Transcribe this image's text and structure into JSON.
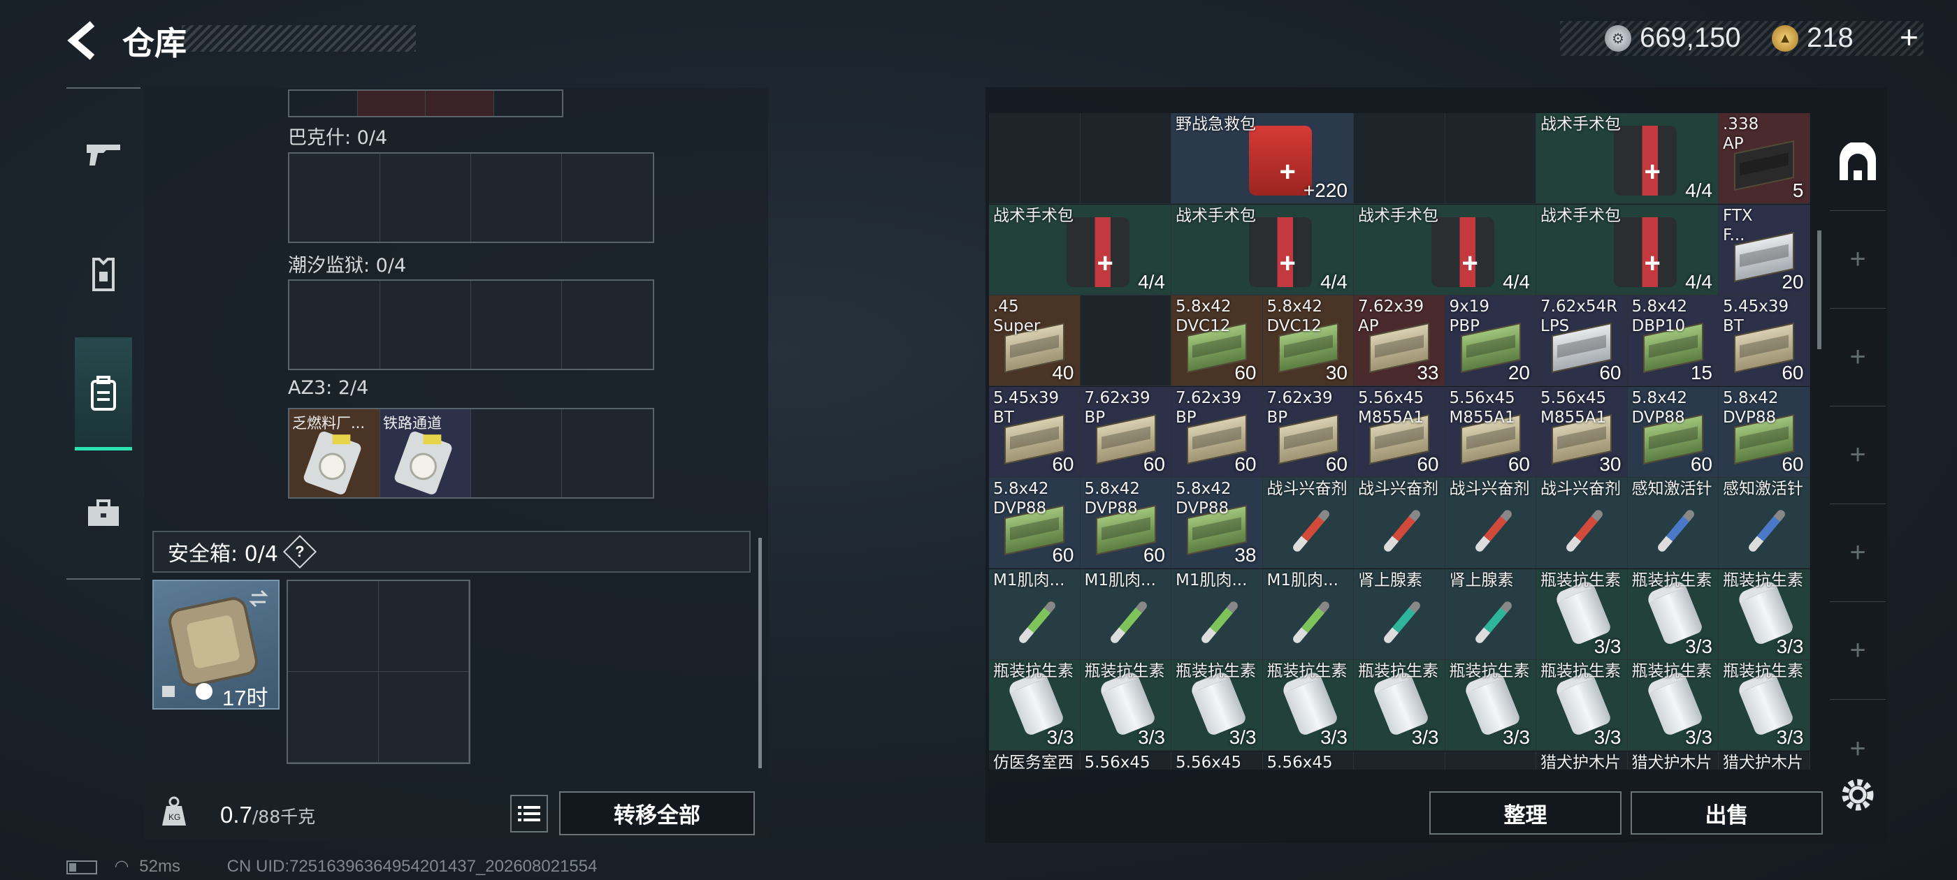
{
  "header": {
    "title": "仓库",
    "currency1": "669,150",
    "currency2": "218",
    "plus": "+"
  },
  "nav": [
    "weapon-icon",
    "armor-icon",
    "backpack-icon",
    "case-icon"
  ],
  "left": {
    "key_sections": [
      {
        "label": "巴克什: 0/4",
        "keys": []
      },
      {
        "label": "潮汐监狱: 0/4",
        "keys": []
      },
      {
        "label": "AZ3: 2/4",
        "keys": [
          "乏燃料厂...",
          "铁路通道"
        ]
      }
    ],
    "safe_label": "安全箱: 0/4",
    "help": "?",
    "safe_timer": "17时",
    "weight_value": "0.7",
    "weight_unit": "/88千克",
    "transfer_all": "转移全部"
  },
  "status": {
    "ping": "52ms",
    "uid": "CN UID:72516396364954201437_202608021554"
  },
  "right": {
    "sort_label": "整理",
    "sell_label": "出售",
    "rows": [
      [
        {
          "n": "",
          "c": "",
          "bg": "dark",
          "t": ""
        },
        {
          "n": "",
          "c": "",
          "bg": "dark",
          "t": ""
        },
        {
          "n": "野战急救包",
          "c": "+220",
          "bg": "blue",
          "t": "medkit",
          "w": 2
        },
        {
          "n": "",
          "c": "",
          "bg": "dark",
          "t": ""
        },
        {
          "n": "",
          "c": "",
          "bg": "dark",
          "t": ""
        },
        {
          "n": "战术手术包",
          "c": "4/4",
          "bg": "green",
          "t": "kit",
          "w": 2
        },
        {
          "n": ".338\nAP",
          "c": "5",
          "bg": "red",
          "t": "box"
        }
      ],
      [
        {
          "n": "战术手术包",
          "c": "4/4",
          "bg": "green",
          "t": "kit",
          "w": 2
        },
        {
          "n": "战术手术包",
          "c": "4/4",
          "bg": "green",
          "t": "kit",
          "w": 2
        },
        {
          "n": "战术手术包",
          "c": "4/4",
          "bg": "green",
          "t": "kit",
          "w": 2
        },
        {
          "n": "战术手术包",
          "c": "4/4",
          "bg": "green",
          "t": "kit",
          "w": 2
        },
        {
          "n": "FTX\nF...",
          "c": "20",
          "bg": "purple",
          "t": "ammow"
        }
      ],
      [
        {
          "n": ".45\nSuper",
          "c": "40",
          "bg": "orange",
          "t": "ammo"
        },
        {
          "n": "",
          "c": "",
          "bg": "dark",
          "t": ""
        },
        {
          "n": "5.8x42\nDVC12",
          "c": "60",
          "bg": "orange",
          "t": "ammog"
        },
        {
          "n": "5.8x42\nDVC12",
          "c": "30",
          "bg": "orange",
          "t": "ammog"
        },
        {
          "n": "7.62x39\nAP",
          "c": "33",
          "bg": "red",
          "t": "ammo"
        },
        {
          "n": "9x19\nPBP",
          "c": "20",
          "bg": "purple",
          "t": "ammog"
        },
        {
          "n": "7.62x54R\nLPS",
          "c": "60",
          "bg": "purple",
          "t": "ammow"
        },
        {
          "n": "5.8x42\nDBP10",
          "c": "15",
          "bg": "purple",
          "t": "ammog"
        },
        {
          "n": "5.45x39\nBT",
          "c": "60",
          "bg": "purple",
          "t": "ammo"
        }
      ],
      [
        {
          "n": "5.45x39\nBT",
          "c": "60",
          "bg": "purple",
          "t": "ammo"
        },
        {
          "n": "7.62x39\nBP",
          "c": "60",
          "bg": "purple",
          "t": "ammo"
        },
        {
          "n": "7.62x39\nBP",
          "c": "60",
          "bg": "purple",
          "t": "ammo"
        },
        {
          "n": "7.62x39\nBP",
          "c": "60",
          "bg": "purple",
          "t": "ammo"
        },
        {
          "n": "5.56x45\nM855A1",
          "c": "60",
          "bg": "purple",
          "t": "ammo"
        },
        {
          "n": "5.56x45\nM855A1",
          "c": "60",
          "bg": "purple",
          "t": "ammo"
        },
        {
          "n": "5.56x45\nM855A1",
          "c": "30",
          "bg": "purple",
          "t": "ammo"
        },
        {
          "n": "5.8x42\nDVP88",
          "c": "60",
          "bg": "blue",
          "t": "ammog"
        },
        {
          "n": "5.8x42\nDVP88",
          "c": "60",
          "bg": "blue",
          "t": "ammog"
        }
      ],
      [
        {
          "n": "5.8x42\nDVP88",
          "c": "60",
          "bg": "blue",
          "t": "ammog"
        },
        {
          "n": "5.8x42\nDVP88",
          "c": "60",
          "bg": "blue",
          "t": "ammog"
        },
        {
          "n": "5.8x42\nDVP88",
          "c": "38",
          "bg": "blue",
          "t": "ammog"
        },
        {
          "n": "战斗兴奋剂",
          "c": "",
          "bg": "teal",
          "t": "injr"
        },
        {
          "n": "战斗兴奋剂",
          "c": "",
          "bg": "teal",
          "t": "injr"
        },
        {
          "n": "战斗兴奋剂",
          "c": "",
          "bg": "teal",
          "t": "injr"
        },
        {
          "n": "战斗兴奋剂",
          "c": "",
          "bg": "teal",
          "t": "injr"
        },
        {
          "n": "感知激活针",
          "c": "",
          "bg": "teal",
          "t": "injb"
        },
        {
          "n": "感知激活针",
          "c": "",
          "bg": "teal",
          "t": "injb"
        }
      ],
      [
        {
          "n": "M1肌肉...",
          "c": "",
          "bg": "teal",
          "t": "injg"
        },
        {
          "n": "M1肌肉...",
          "c": "",
          "bg": "teal",
          "t": "injg"
        },
        {
          "n": "M1肌肉...",
          "c": "",
          "bg": "teal",
          "t": "injg"
        },
        {
          "n": "M1肌肉...",
          "c": "",
          "bg": "teal",
          "t": "injg"
        },
        {
          "n": "肾上腺素",
          "c": "",
          "bg": "teal",
          "t": "injt"
        },
        {
          "n": "肾上腺素",
          "c": "",
          "bg": "teal",
          "t": "injt"
        },
        {
          "n": "瓶装抗生素",
          "c": "3/3",
          "bg": "green",
          "t": "bottle"
        },
        {
          "n": "瓶装抗生素",
          "c": "3/3",
          "bg": "green",
          "t": "bottle"
        },
        {
          "n": "瓶装抗生素",
          "c": "3/3",
          "bg": "green",
          "t": "bottle"
        }
      ],
      [
        {
          "n": "瓶装抗生素",
          "c": "3/3",
          "bg": "green",
          "t": "bottle"
        },
        {
          "n": "瓶装抗生素",
          "c": "3/3",
          "bg": "green",
          "t": "bottle"
        },
        {
          "n": "瓶装抗生素",
          "c": "3/3",
          "bg": "green",
          "t": "bottle"
        },
        {
          "n": "瓶装抗生素",
          "c": "3/3",
          "bg": "green",
          "t": "bottle"
        },
        {
          "n": "瓶装抗生素",
          "c": "3/3",
          "bg": "green",
          "t": "bottle"
        },
        {
          "n": "瓶装抗生素",
          "c": "3/3",
          "bg": "green",
          "t": "bottle"
        },
        {
          "n": "瓶装抗生素",
          "c": "3/3",
          "bg": "green",
          "t": "bottle"
        },
        {
          "n": "瓶装抗生素",
          "c": "3/3",
          "bg": "green",
          "t": "bottle"
        },
        {
          "n": "瓶装抗生素",
          "c": "3/3",
          "bg": "green",
          "t": "bottle"
        }
      ],
      [
        {
          "n": "仿医务室西",
          "c": "",
          "bg": "dark",
          "t": ""
        },
        {
          "n": "5.56x45",
          "c": "",
          "bg": "dark",
          "t": ""
        },
        {
          "n": "5.56x45",
          "c": "",
          "bg": "dark",
          "t": ""
        },
        {
          "n": "5.56x45",
          "c": "",
          "bg": "dark",
          "t": ""
        },
        {
          "n": "",
          "c": "",
          "bg": "dark",
          "t": ""
        },
        {
          "n": "",
          "c": "",
          "bg": "dark",
          "t": ""
        },
        {
          "n": "猎犬护木片",
          "c": "",
          "bg": "dark",
          "t": ""
        },
        {
          "n": "猎犬护木片",
          "c": "",
          "bg": "dark",
          "t": ""
        },
        {
          "n": "猎犬护木片",
          "c": "",
          "bg": "dark",
          "t": ""
        }
      ]
    ]
  }
}
